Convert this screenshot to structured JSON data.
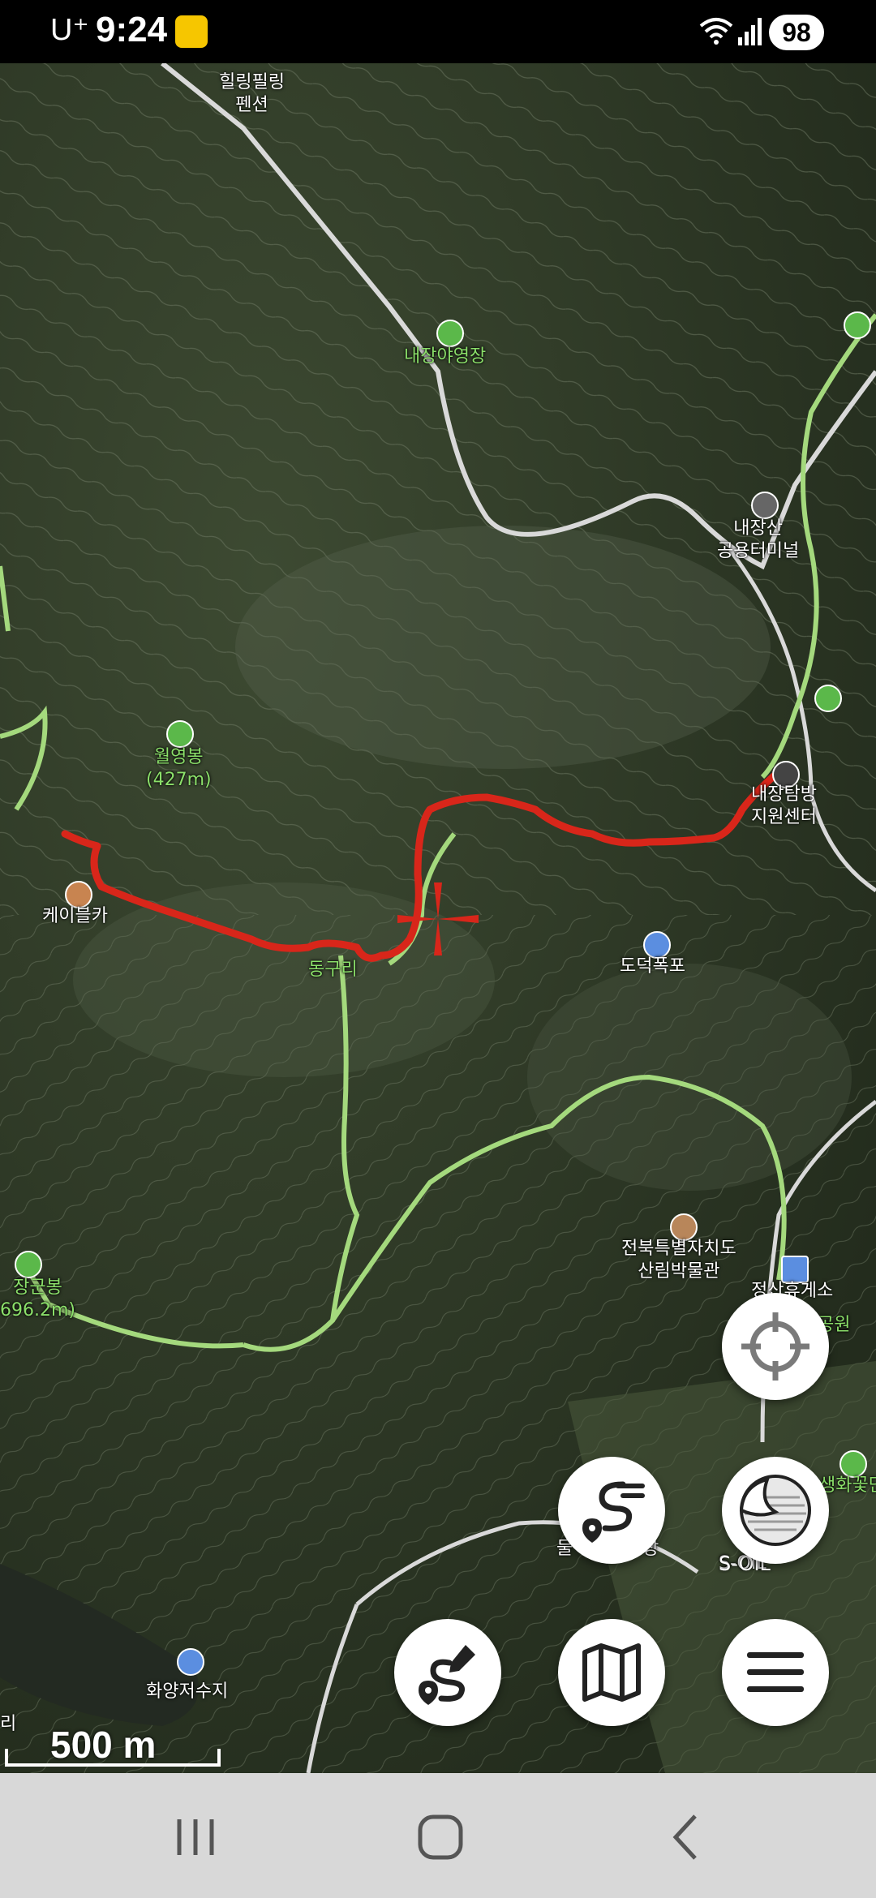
{
  "status_bar": {
    "carrier": "U⁺",
    "time": "9:24",
    "battery": "98"
  },
  "map": {
    "labels": {
      "healing_pension": "힐링필링\n펜션",
      "naejang_campsite": "내장야영장",
      "bus_terminal": "내장산\n공용터미널",
      "wolyeongbong": "월영봉\n(427m)",
      "cable_car": "케이블카",
      "dongguri": "동구리",
      "dodeok_falls": "도덕폭포",
      "visitor_center": "내장탐방\n지원센터",
      "arboretum": "전북특별자치도\n산림박물관",
      "rest_area": "정산휴게소",
      "park": "공원",
      "janggunbong": "장군봉\n696.2m)",
      "dulle_place": "둘",
      "sang_place": "장",
      "soil": "S-OIL",
      "flower_place": "생화꽃단",
      "hwayang_reservoir": "화양저수지",
      "left_edge": "리"
    }
  },
  "scale_bar": {
    "label": "500 m"
  },
  "buttons": {
    "locate": "locate-icon",
    "route_list": "route-list-icon",
    "layers": "layers-icon",
    "draw_route": "draw-route-icon",
    "map_type": "map-icon",
    "menu": "menu-icon"
  },
  "colors": {
    "track": "#d8261a",
    "trail": "#a4d97d",
    "road": "#d9d9d9"
  }
}
